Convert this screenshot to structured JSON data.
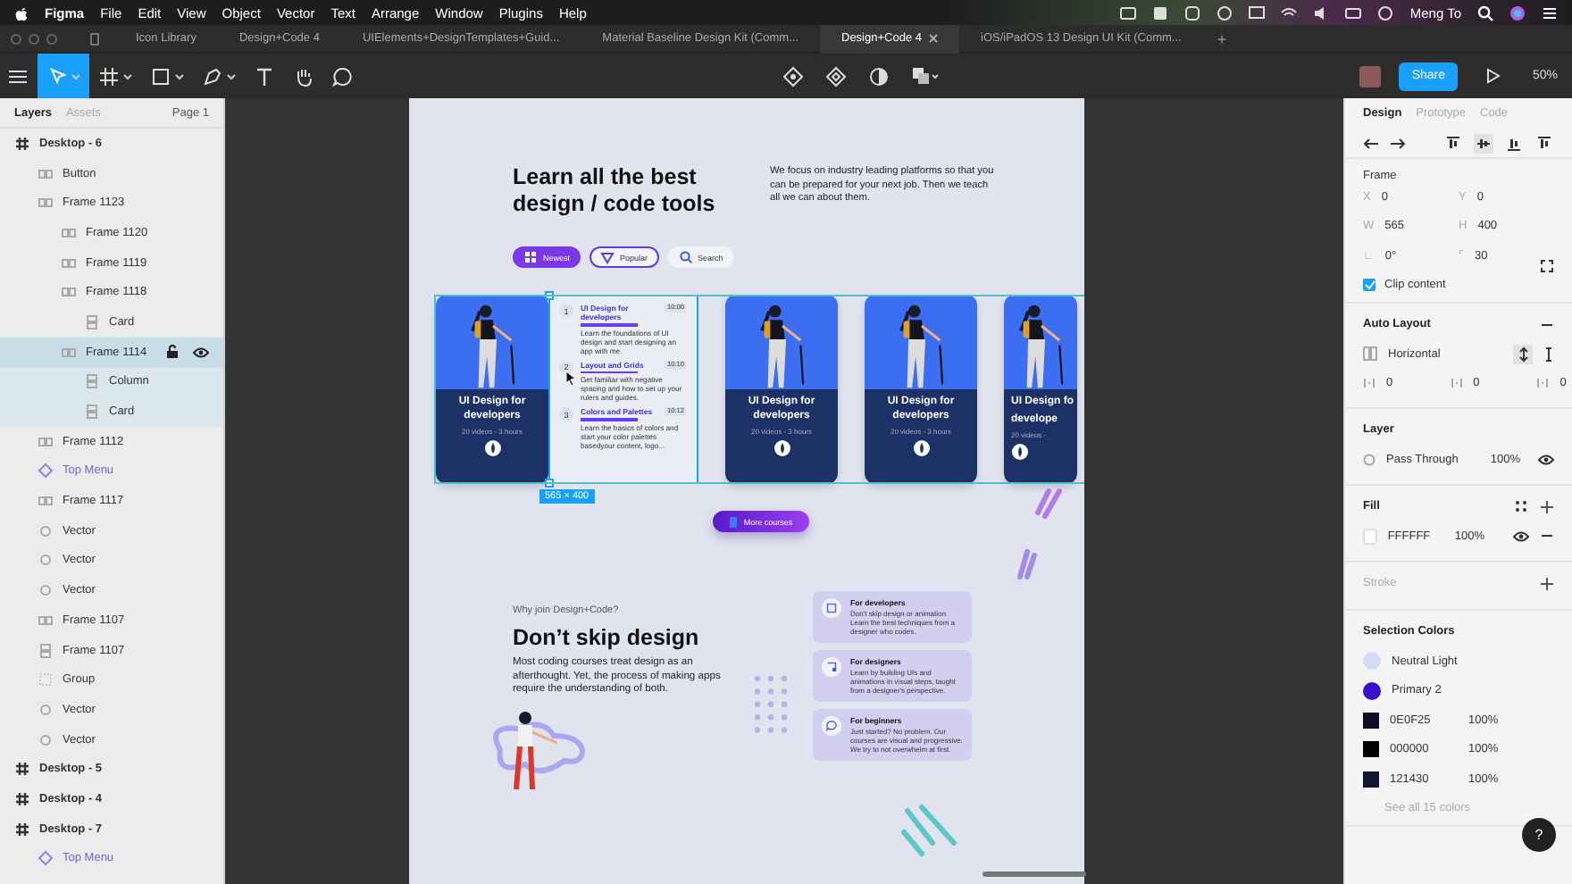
{
  "menubar": {
    "items": [
      "Figma",
      "File",
      "Edit",
      "View",
      "Object",
      "Vector",
      "Text",
      "Arrange",
      "Window",
      "Plugins",
      "Help"
    ],
    "user": "Meng To"
  },
  "tabs": [
    {
      "label": "Icon Library",
      "selected": false
    },
    {
      "label": "Design+Code 4",
      "selected": false
    },
    {
      "label": "UIElements+DesignTemplates+Guid...",
      "selected": false
    },
    {
      "label": "Material Baseline Design Kit (Comm...",
      "selected": false
    },
    {
      "label": "Design+Code 4",
      "selected": true
    },
    {
      "label": "iOS/iPadOS 13 Design UI Kit (Comm...",
      "selected": false
    }
  ],
  "new_tab": "+",
  "toolbar": {
    "tools": [
      {
        "kind": "move",
        "selected": true
      },
      {
        "kind": "frame",
        "selected": false
      },
      {
        "kind": "shape",
        "selected": false
      },
      {
        "kind": "pen",
        "selected": false
      },
      {
        "kind": "text",
        "selected": false
      },
      {
        "kind": "hand",
        "selected": false
      },
      {
        "kind": "comment",
        "selected": false
      }
    ],
    "share": "Share",
    "zoom": "50%"
  },
  "layers_panel": {
    "tabs": [
      {
        "label": "Layers",
        "selected": true
      },
      {
        "label": "Assets",
        "selected": false
      }
    ],
    "page": "Page 1",
    "layers": [
      {
        "kind": "desktop",
        "name": "Desktop - 6",
        "selected": false,
        "children": [
          {
            "kind": "frame",
            "name": "Button",
            "selected": false
          },
          {
            "kind": "frame",
            "name": "Frame 1123",
            "selected": false,
            "children": [
              {
                "kind": "frame",
                "name": "Frame 1120",
                "selected": false
              },
              {
                "kind": "frame",
                "name": "Frame 1119",
                "selected": false
              },
              {
                "kind": "frame",
                "name": "Frame 1118",
                "selected": false,
                "children": [
                  {
                    "kind": "rect",
                    "name": "Card",
                    "selected": false
                  }
                ]
              },
              {
                "kind": "frame",
                "name": "Frame 1114",
                "selected": true,
                "children": [
                  {
                    "kind": "rect",
                    "name": "Column",
                    "selected": false
                  },
                  {
                    "kind": "rect",
                    "name": "Card",
                    "selected": false
                  }
                ]
              }
            ]
          },
          {
            "kind": "frame",
            "name": "Frame 1112",
            "selected": false
          },
          {
            "kind": "component",
            "name": "Top Menu",
            "selected": false
          },
          {
            "kind": "frame",
            "name": "Frame 1117",
            "selected": false
          },
          {
            "kind": "vector",
            "name": "Vector",
            "selected": false
          },
          {
            "kind": "vector",
            "name": "Vector",
            "selected": false
          },
          {
            "kind": "vector",
            "name": "Vector",
            "selected": false
          },
          {
            "kind": "frame",
            "name": "Frame 1107",
            "selected": false
          },
          {
            "kind": "rect",
            "name": "Frame 1107",
            "selected": false
          },
          {
            "kind": "group",
            "name": "Group",
            "selected": false
          },
          {
            "kind": "vector",
            "name": "Vector",
            "selected": false
          },
          {
            "kind": "vector",
            "name": "Vector",
            "selected": false
          }
        ]
      },
      {
        "kind": "desktop",
        "name": "Desktop - 5",
        "selected": false
      },
      {
        "kind": "desktop",
        "name": "Desktop - 4",
        "selected": false
      },
      {
        "kind": "desktop",
        "name": "Desktop - 7",
        "selected": false,
        "children": [
          {
            "kind": "component",
            "name": "Top Menu",
            "selected": false
          }
        ]
      }
    ]
  },
  "canvas": {
    "heading": "Learn all the best design / code tools",
    "intro": "We focus on industry leading platforms so that you can be prepared for your next job. Then we teach all we can about them.",
    "chips": [
      {
        "label": "Newest",
        "selected": true
      },
      {
        "label": "Popular",
        "selected": false
      },
      {
        "label": "Search",
        "selected": false
      }
    ],
    "cards": [
      {
        "kind": "course",
        "title": "UI Design for developers",
        "meta": "20 videos - 3 hours"
      },
      {
        "kind": "lessons",
        "lessons": [
          {
            "number": "1",
            "title": "UI Design for developers",
            "time": "10:00",
            "text": "Learn the foundations of UI design and start designing an app with me."
          },
          {
            "number": "2",
            "title": "Layout and Grids",
            "time": "10:10",
            "text": "Get familiar with negative spacing and how to set up your rulers and guides."
          },
          {
            "number": "3",
            "title": "Colors and Palettes",
            "time": "10:12",
            "text": "Learn the basics of colors and start your color palettes basedyour content, logo..."
          }
        ]
      },
      {
        "kind": "course",
        "title": "UI Design for developers",
        "meta": "20 videos - 3 hours"
      },
      {
        "kind": "course",
        "title": "UI Design for developers",
        "meta": "20 videos - 3 hours"
      },
      {
        "kind": "course_cut",
        "title_lines": [
          "UI Design fo",
          "develope"
        ],
        "meta": "20 videos -"
      }
    ],
    "selection_size": "565 × 400",
    "more_button": "More courses",
    "eyebrow": "Why join Design+Code?",
    "heading2": "Don’t skip design",
    "body2": "Most coding courses treat design as an afterthought. Yet, the process of making apps require the understanding of both.",
    "features": [
      {
        "title": "For developers",
        "text": "Don't skip design or animation. Learn the best techniques from a designer who codes."
      },
      {
        "title": "For designers",
        "text": "Learn by building UIs and animations in visual steps, taught from a designer's perspective."
      },
      {
        "title": "For beginners",
        "text": "Just started? No problem. Our courses are visual and progressive. We try to not overwhelm at first."
      }
    ]
  },
  "design_panel": {
    "tabs": [
      {
        "label": "Design",
        "selected": true
      },
      {
        "label": "Prototype",
        "selected": false
      },
      {
        "label": "Code",
        "selected": false
      }
    ],
    "frame_label": "Frame",
    "fields": [
      {
        "label": "X",
        "value": "0"
      },
      {
        "label": "Y",
        "value": "0"
      },
      {
        "label": "W",
        "value": "565"
      },
      {
        "label": "H",
        "value": "400"
      },
      {
        "label": "∟",
        "value": "0°"
      },
      {
        "label": "⌜",
        "value": "30"
      }
    ],
    "clip_content": {
      "label": "Clip content",
      "checked": true
    },
    "auto_layout": {
      "title": "Auto Layout",
      "direction": "Horizontal",
      "spacing": [
        "0",
        "0",
        "0"
      ]
    },
    "layer": {
      "title": "Layer",
      "blend": "Pass Through",
      "opacity": "100%"
    },
    "fill": {
      "title": "Fill",
      "hex": "FFFFFF",
      "opacity": "100%"
    },
    "stroke": {
      "title": "Stroke"
    },
    "selection_colors": {
      "title": "Selection Colors",
      "colors": [
        {
          "kind": "style",
          "name": "Neutral Light",
          "color": "#d5dbf2"
        },
        {
          "kind": "style",
          "name": "Primary 2",
          "color": "#3a0fc8"
        },
        {
          "kind": "hex",
          "name": "0E0F25",
          "color": "#0e0f25",
          "opacity": "100%"
        },
        {
          "kind": "hex",
          "name": "000000",
          "color": "#000000",
          "opacity": "100%"
        },
        {
          "kind": "hex",
          "name": "121430",
          "color": "#121430",
          "opacity": "100%"
        }
      ],
      "see_all": "See all 15 colors"
    },
    "help": "?"
  }
}
